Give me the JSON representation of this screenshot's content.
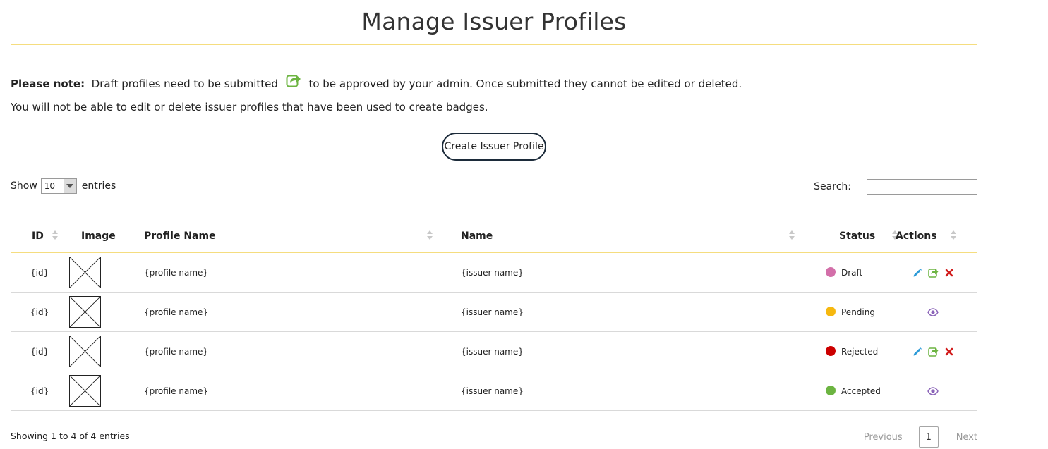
{
  "page": {
    "title": "Manage Issuer Profiles"
  },
  "notice": {
    "label": "Please note:",
    "text_before_icon": "Draft profiles need to be submitted",
    "icon": "share-icon",
    "text_after_icon": "to be approved by your admin. Once submitted they cannot be edited or deleted.",
    "line2": "You will not be able to edit or delete issuer profiles that have been used to create badges."
  },
  "create_button": {
    "label": "Create Issuer Profile"
  },
  "length_control": {
    "prefix": "Show",
    "value": "10",
    "suffix": "entries"
  },
  "search": {
    "label": "Search:",
    "value": ""
  },
  "table": {
    "columns": [
      "ID",
      "Image",
      "Profile Name",
      "Name",
      "Status",
      "Actions"
    ],
    "rows": [
      {
        "id": "{id}",
        "profile_name": "{profile name}",
        "name": "{issuer name}",
        "status": "Draft",
        "status_color": "#d36fa9",
        "actions": [
          "edit",
          "submit",
          "delete"
        ]
      },
      {
        "id": "{id}",
        "profile_name": "{profile name}",
        "name": "{issuer name}",
        "status": "Pending",
        "status_color": "#f6b80f",
        "actions": [
          "view"
        ]
      },
      {
        "id": "{id}",
        "profile_name": "{profile name}",
        "name": "{issuer name}",
        "status": "Rejected",
        "status_color": "#cc0000",
        "actions": [
          "edit",
          "submit",
          "delete"
        ]
      },
      {
        "id": "{id}",
        "profile_name": "{profile name}",
        "name": "{issuer name}",
        "status": "Accepted",
        "status_color": "#6cb441",
        "actions": [
          "view"
        ]
      }
    ]
  },
  "footer": {
    "info": "Showing 1 to 4 of 4 entries",
    "previous": "Previous",
    "page": "1",
    "next": "Next"
  },
  "colors": {
    "accent_rule": "#f5dd7f",
    "edit": "#2d9bd8",
    "submit": "#6cb441",
    "delete": "#d11c1c",
    "view": "#8a63b8"
  }
}
